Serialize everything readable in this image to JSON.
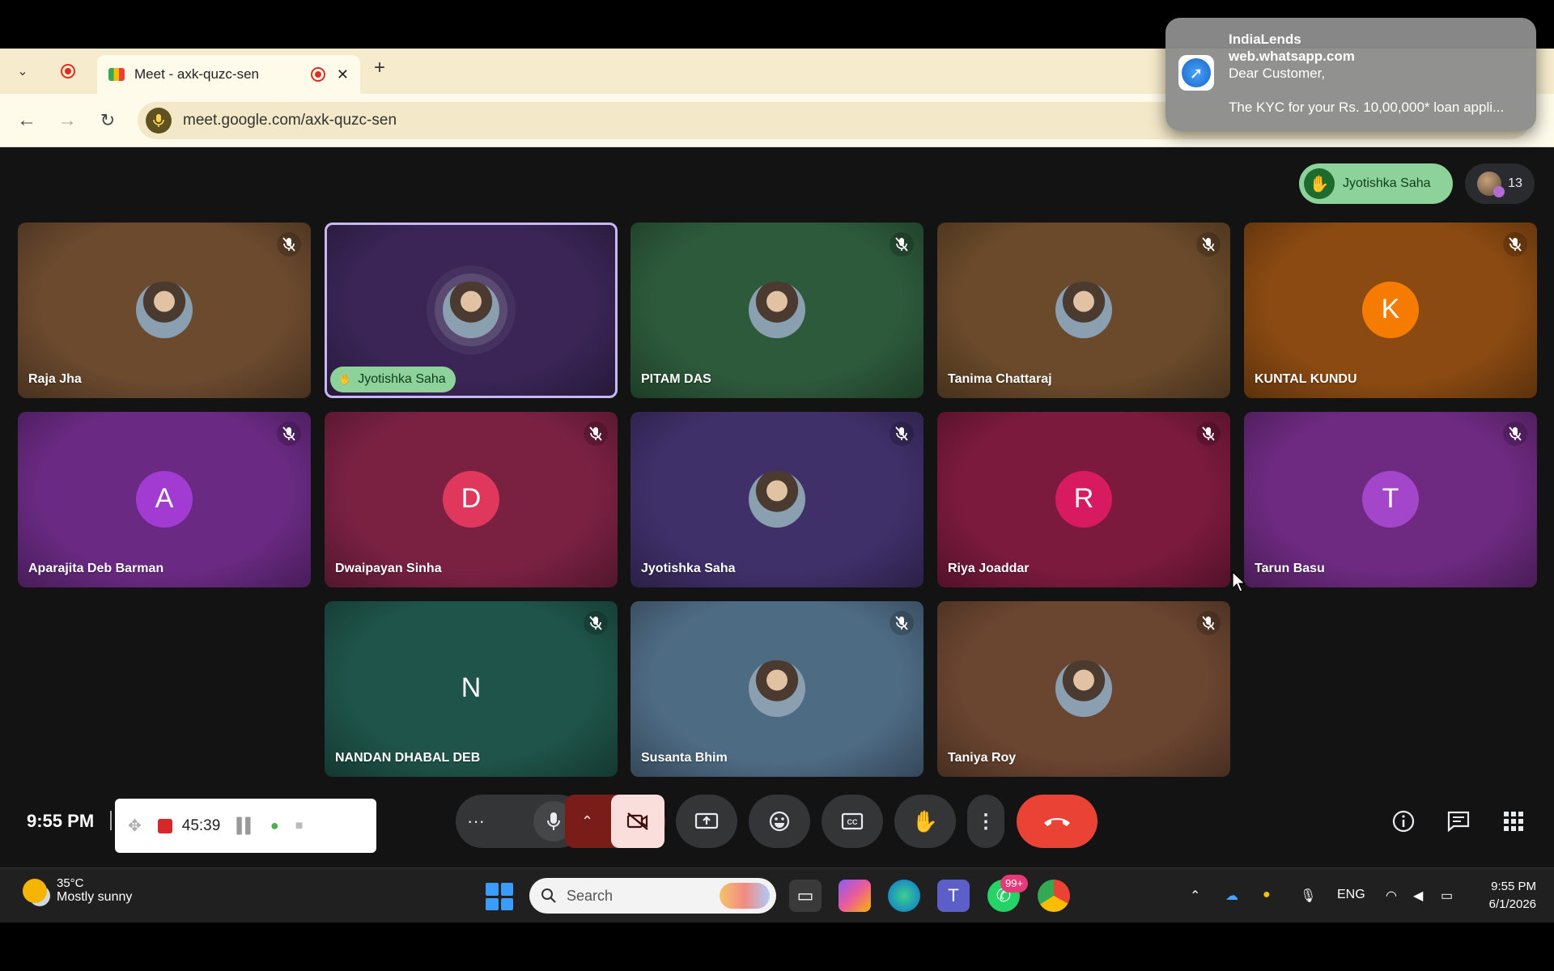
{
  "browser": {
    "tab_title": "Meet - axk-quzc-sen",
    "url": "meet.google.com/axk-quzc-sen"
  },
  "notification": {
    "app": "IndiaLends",
    "source": "web.whatsapp.com",
    "greeting": "Dear Customer,",
    "body": "The KYC for your Rs. 10,00,000* loan appli..."
  },
  "meet": {
    "raised_hand_name": "Jyotishka Saha",
    "participant_count": "13",
    "tiles": [
      {
        "name": "Raja Jha",
        "avatar": "photo",
        "bg": "#6b4a2e"
      },
      {
        "name": "Jyotishka Saha",
        "avatar": "photo",
        "bg": "#3a2556",
        "active": true
      },
      {
        "name": "PITAM DAS",
        "avatar": "photo",
        "bg": "#2d5a3b"
      },
      {
        "name": "Tanima Chattaraj",
        "avatar": "photo",
        "bg": "#6a4a2a"
      },
      {
        "name": "KUNTAL KUNDU",
        "avatar": "K",
        "avatar_color": "#f57c00",
        "bg": "#8a4a12"
      },
      {
        "name": "Aparajita Deb Barman",
        "avatar": "A",
        "avatar_color": "#a23bd1",
        "bg": "#6a2a83"
      },
      {
        "name": "Dwaipayan Sinha",
        "avatar": "D",
        "avatar_color": "#e0375c",
        "bg": "#7a2142"
      },
      {
        "name": "Jyotishka Saha",
        "avatar": "photo",
        "bg": "#40306a"
      },
      {
        "name": "Riya Joaddar",
        "avatar": "R",
        "avatar_color": "#d81b60",
        "bg": "#7b1a3c"
      },
      {
        "name": "Tarun Basu",
        "avatar": "T",
        "avatar_color": "#a346c9",
        "bg": "#6d2a80"
      },
      {
        "name": "NANDAN DHABAL DEB",
        "avatar": "N",
        "avatar_color": "transparent",
        "bg": "#1e5449"
      },
      {
        "name": "Susanta Bhim",
        "avatar": "photo",
        "bg": "#4e6b84"
      },
      {
        "name": "Taniya Roy",
        "avatar": "photo",
        "bg": "#6a4530"
      }
    ],
    "clock": "9:55 PM",
    "recording_time": "45:39"
  },
  "taskbar": {
    "temperature": "35°C",
    "weather": "Mostly sunny",
    "search_placeholder": "Search",
    "whatsapp_badge": "99+",
    "language": "ENG",
    "time": "9:55 PM",
    "date": "6/1/2026"
  }
}
